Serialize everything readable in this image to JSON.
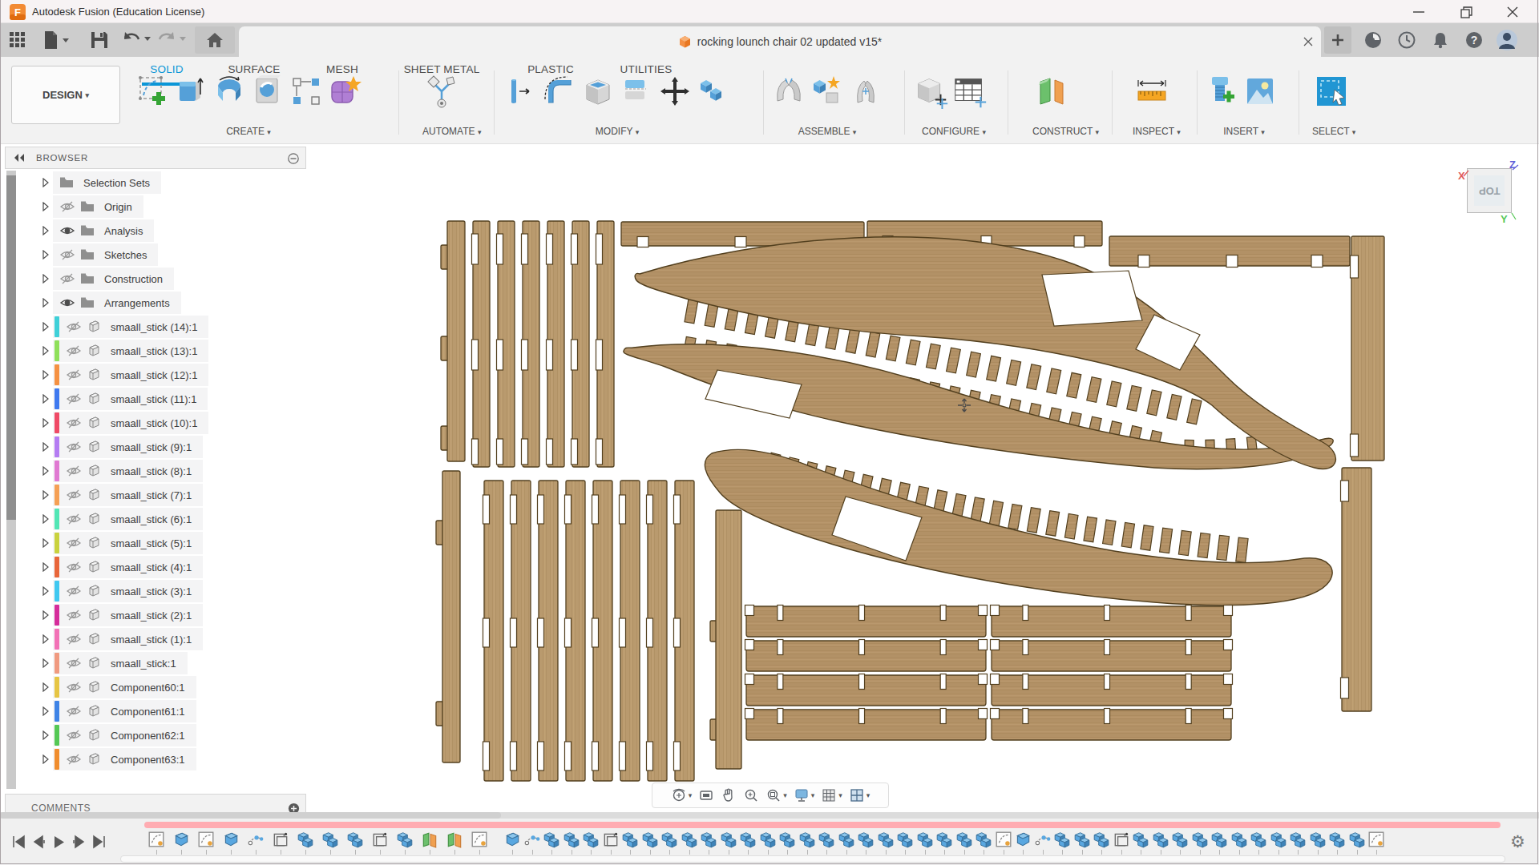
{
  "window": {
    "title": "Autodesk Fusion (Education License)"
  },
  "qat": {
    "doc_tab": {
      "title": "rocking lounch chair 02 updated v15*"
    }
  },
  "ribbon": {
    "design_label": "DESIGN",
    "tabs": [
      {
        "label": "SOLID",
        "active": true
      },
      {
        "label": "SURFACE",
        "active": false
      },
      {
        "label": "MESH",
        "active": false
      },
      {
        "label": "SHEET METAL",
        "active": false
      },
      {
        "label": "PLASTIC",
        "active": false
      },
      {
        "label": "UTILITIES",
        "active": false
      }
    ],
    "groups": [
      {
        "label": "CREATE",
        "icons": [
          "create-sketch",
          "extrude",
          "revolve",
          "hole",
          "pattern",
          "form"
        ]
      },
      {
        "label": "AUTOMATE",
        "icons": [
          "automate"
        ]
      },
      {
        "label": "MODIFY",
        "icons": [
          "press-pull",
          "fillet",
          "shell",
          "offset",
          "move",
          "combine"
        ]
      },
      {
        "label": "ASSEMBLE",
        "icons": [
          "joint",
          "new-component",
          "joint-origin"
        ]
      },
      {
        "label": "CONFIGURE",
        "icons": [
          "configuration",
          "config-table"
        ]
      },
      {
        "label": "CONSTRUCT",
        "icons": [
          "construction-planes"
        ]
      },
      {
        "label": "INSPECT",
        "icons": [
          "measure"
        ]
      },
      {
        "label": "INSERT",
        "icons": [
          "insert-fastener",
          "insert-canvas"
        ]
      },
      {
        "label": "SELECT",
        "icons": [
          "select"
        ]
      }
    ]
  },
  "browser": {
    "header": "BROWSER",
    "comments_label": "COMMENTS",
    "items": [
      {
        "label": "Selection Sets",
        "kind": "folder",
        "eye": "none",
        "color": ""
      },
      {
        "label": "Origin",
        "kind": "folder",
        "eye": "off",
        "color": ""
      },
      {
        "label": "Analysis",
        "kind": "folder",
        "eye": "on",
        "color": ""
      },
      {
        "label": "Sketches",
        "kind": "folder",
        "eye": "off",
        "color": ""
      },
      {
        "label": "Construction",
        "kind": "folder",
        "eye": "off",
        "color": ""
      },
      {
        "label": "Arrangements",
        "kind": "folder",
        "eye": "on",
        "color": ""
      },
      {
        "label": "smaall_stick (14):1",
        "kind": "component",
        "eye": "off",
        "color": "#3fd0d8"
      },
      {
        "label": "smaall_stick (13):1",
        "kind": "component",
        "eye": "off",
        "color": "#8fe05a"
      },
      {
        "label": "smaall_stick (12):1",
        "kind": "component",
        "eye": "off",
        "color": "#f59142"
      },
      {
        "label": "smaall_stick (11):1",
        "kind": "component",
        "eye": "off",
        "color": "#3f79ef"
      },
      {
        "label": "smaall_stick (10):1",
        "kind": "component",
        "eye": "off",
        "color": "#ef4a66"
      },
      {
        "label": "smaall_stick (9):1",
        "kind": "component",
        "eye": "off",
        "color": "#b47cf2"
      },
      {
        "label": "smaall_stick (8):1",
        "kind": "component",
        "eye": "off",
        "color": "#e07ad2"
      },
      {
        "label": "smaall_stick (7):1",
        "kind": "component",
        "eye": "off",
        "color": "#f5a055"
      },
      {
        "label": "smaall_stick (6):1",
        "kind": "component",
        "eye": "off",
        "color": "#52e6b5"
      },
      {
        "label": "smaall_stick (5):1",
        "kind": "component",
        "eye": "off",
        "color": "#c9d23e"
      },
      {
        "label": "smaall_stick (4):1",
        "kind": "component",
        "eye": "off",
        "color": "#e8663a"
      },
      {
        "label": "smaall_stick (3):1",
        "kind": "component",
        "eye": "off",
        "color": "#40c8f0"
      },
      {
        "label": "smaall_stick (2):1",
        "kind": "component",
        "eye": "off",
        "color": "#d52d9b"
      },
      {
        "label": "smaall_stick (1):1",
        "kind": "component",
        "eye": "off",
        "color": "#f272b6"
      },
      {
        "label": "smaall_stick:1",
        "kind": "component",
        "eye": "off",
        "color": "#f09a80"
      },
      {
        "label": "Component60:1",
        "kind": "component",
        "eye": "off",
        "color": "#e6c544"
      },
      {
        "label": "Component61:1",
        "kind": "component",
        "eye": "off",
        "color": "#3f84e6"
      },
      {
        "label": "Component62:1",
        "kind": "component",
        "eye": "off",
        "color": "#55c855"
      },
      {
        "label": "Component63:1",
        "kind": "component",
        "eye": "off",
        "color": "#f08d2e"
      }
    ]
  },
  "viewcube": {
    "face_label": "TOP",
    "axis_x": "X",
    "axis_y": "Y",
    "axis_z": "Z"
  },
  "navbar": {
    "icons": [
      "orbit",
      "look-at",
      "pan",
      "zoom",
      "fit",
      "display-settings",
      "grid-display",
      "viewports"
    ]
  },
  "timeline": {
    "playback": [
      "go-to-start",
      "step-back",
      "play",
      "step-forward",
      "go-to-end"
    ],
    "features_row1": [
      "sk",
      "ex",
      "sk",
      "ex",
      "sp",
      "ol",
      "cb",
      "cb",
      "cb",
      "ol",
      "cb",
      "pl",
      "pl",
      "sk"
    ],
    "features_row2": [
      "ex",
      "sp",
      "cb",
      "cb",
      "cb",
      "ol",
      "cb",
      "cb",
      "cb",
      "cb",
      "cb",
      "cb",
      "cb",
      "cb",
      "cb",
      "cb",
      "cb",
      "cb",
      "cb",
      "cb",
      "cb",
      "cb",
      "cb",
      "cb",
      "cb",
      "sk",
      "ex",
      "sp",
      "cb",
      "cb",
      "cb",
      "ol",
      "cb",
      "cb",
      "cb",
      "cb",
      "cb",
      "cb",
      "cb",
      "cb",
      "cb",
      "cb",
      "cb",
      "cb",
      "sk"
    ]
  }
}
